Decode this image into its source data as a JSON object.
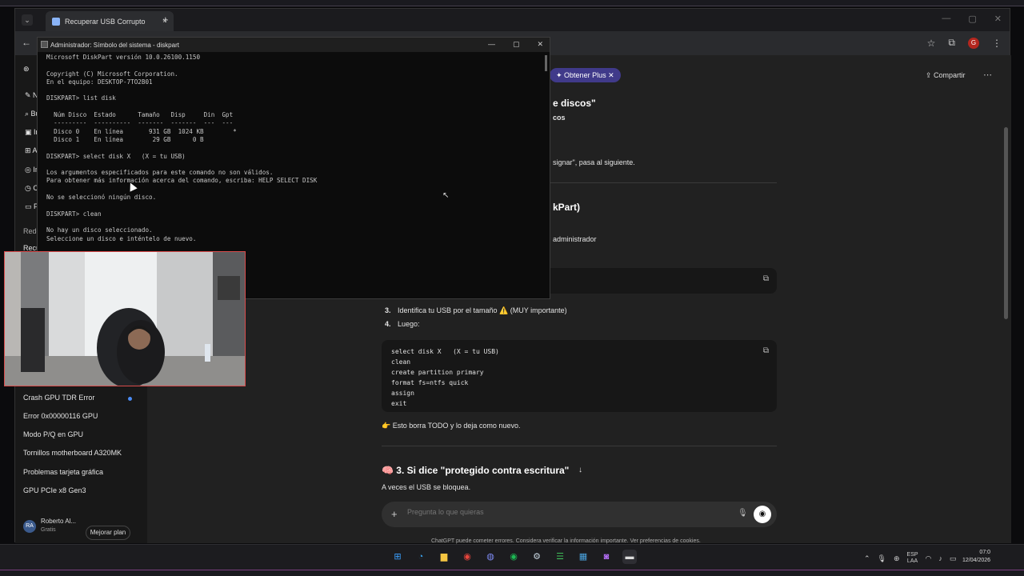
{
  "browser": {
    "tab_title": "Recuperar USB Corrupto",
    "tab_close": "×",
    "new_tab": "+",
    "profile_letter": "G"
  },
  "header": {
    "plus_badge": "Obtener Plus",
    "share": "Compartir"
  },
  "sidebar": {
    "partial_items": [
      "Nu",
      "Bu",
      "Im",
      "Ap",
      "Im",
      "Co",
      "Pre"
    ],
    "section": "Redenti",
    "partial_recent": "Recupe",
    "items": [
      "Crash GPU TDR Error",
      "Error 0x00000116 GPU",
      "Modo P/Q en GPU",
      "Tornillos motherboard A320MK",
      "Problemas tarjeta gráfica",
      "GPU PCIe x8 Gen3"
    ],
    "user_initials": "RA",
    "user_name": "Roberto Al...",
    "user_plan": "Gratis",
    "upgrade": "Mejorar plan"
  },
  "chat": {
    "frag_heading1": "e discos\"",
    "frag_sub1": "cos",
    "frag_text1": "signar\", pasa al siguiente.",
    "frag_heading2": "kPart)",
    "frag_text2": "administrador",
    "step3": "Identifica tu USB por el tamaño ⚠️ (MUY importante)",
    "step3_num": "3.",
    "step4_num": "4.",
    "step4": "Luego:",
    "code": "select disk X   (X = tu USB)\nclean\ncreate partition primary\nformat fs=ntfs quick\nassign\nexit",
    "note": "👉 Esto borra TODO y lo deja como nuevo.",
    "section3": "🧠 3. Si dice \"protegido contra escritura\"",
    "section3_text": "A veces el USB se bloquea.",
    "composer_placeholder": "Pregunta lo que quieras",
    "disclaimer": "ChatGPT puede cometer errores. Considera verificar la información importante. Ver preferencias de cookies."
  },
  "cmd": {
    "title": "Administrador: Símbolo del sistema - diskpart",
    "output": "Microsoft DiskPart versión 10.0.26100.1150\n\nCopyright (C) Microsoft Corporation.\nEn el equipo: DESKTOP-7TO2B01\n\nDISKPART> list disk\n\n  Núm Disco  Estado      Tamaño   Disp     Din  Gpt\n  ---------  ----------  -------  -------  ---  ---\n  Disco 0    En línea       931 GB  1024 KB        *\n  Disco 1    En línea        29 GB      0 B\n\nDISKPART> select disk X   (X = tu USB)\n\nLos argumentos especificados para este comando no son válidos.\nPara obtener más información acerca del comando, escriba: HELP SELECT DISK\n\nNo se seleccionó ningún disco.\n\nDISKPART> clean\n\nNo hay un disco seleccionado.\nSeleccione un disco e inténtelo de nuevo.\n\n\n\n                                               ción."
  },
  "taskbar": {
    "lang_top": "ESP",
    "lang_bottom": "LAA",
    "time": "07:0",
    "date": "12/04/2026"
  },
  "colors": {
    "plus_badge": "#403a8a",
    "cmd_bg": "#0c0c0c",
    "page_bg": "#212121",
    "sidebar_bg": "#181818",
    "cam_border": "#d94b4b"
  }
}
